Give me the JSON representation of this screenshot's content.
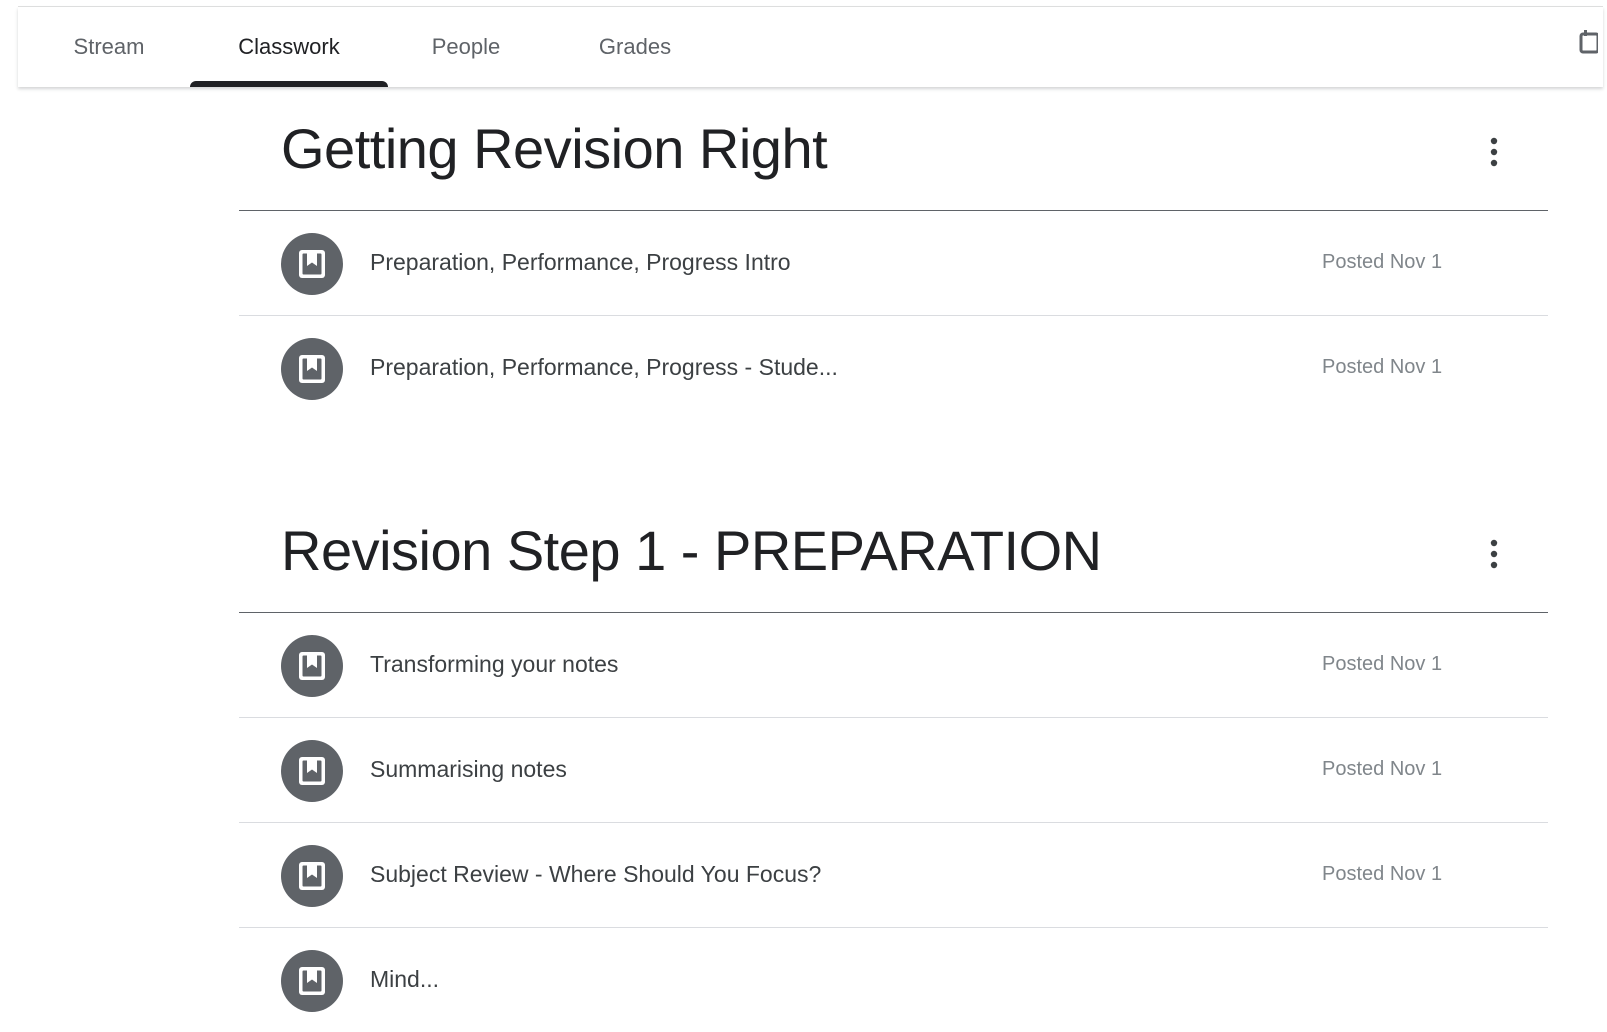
{
  "tabs": {
    "stream": "Stream",
    "classwork": "Classwork",
    "people": "People",
    "grades": "Grades",
    "active": "Classwork"
  },
  "topics": [
    {
      "title": "Getting Revision Right",
      "items": [
        {
          "title": "Preparation, Performance, Progress Intro",
          "posted": "Posted Nov 1",
          "icon": "material-icon"
        },
        {
          "title": "Preparation, Performance, Progress - Stude...",
          "posted": "Posted Nov 1",
          "icon": "material-icon"
        }
      ]
    },
    {
      "title": "Revision Step 1 - PREPARATION",
      "items": [
        {
          "title": "Transforming your notes",
          "posted": "Posted Nov 1",
          "icon": "material-icon"
        },
        {
          "title": "Summarising notes",
          "posted": "Posted Nov 1",
          "icon": "material-icon"
        },
        {
          "title": "Subject Review - Where Should You Focus?",
          "posted": "Posted Nov 1",
          "icon": "material-icon"
        },
        {
          "title": "Mind...",
          "posted": "",
          "icon": "material-icon"
        }
      ]
    }
  ],
  "colors": {
    "icon_bg": "#5f6368",
    "active_tab_indicator": "#202124",
    "divider": "#dadce0"
  }
}
